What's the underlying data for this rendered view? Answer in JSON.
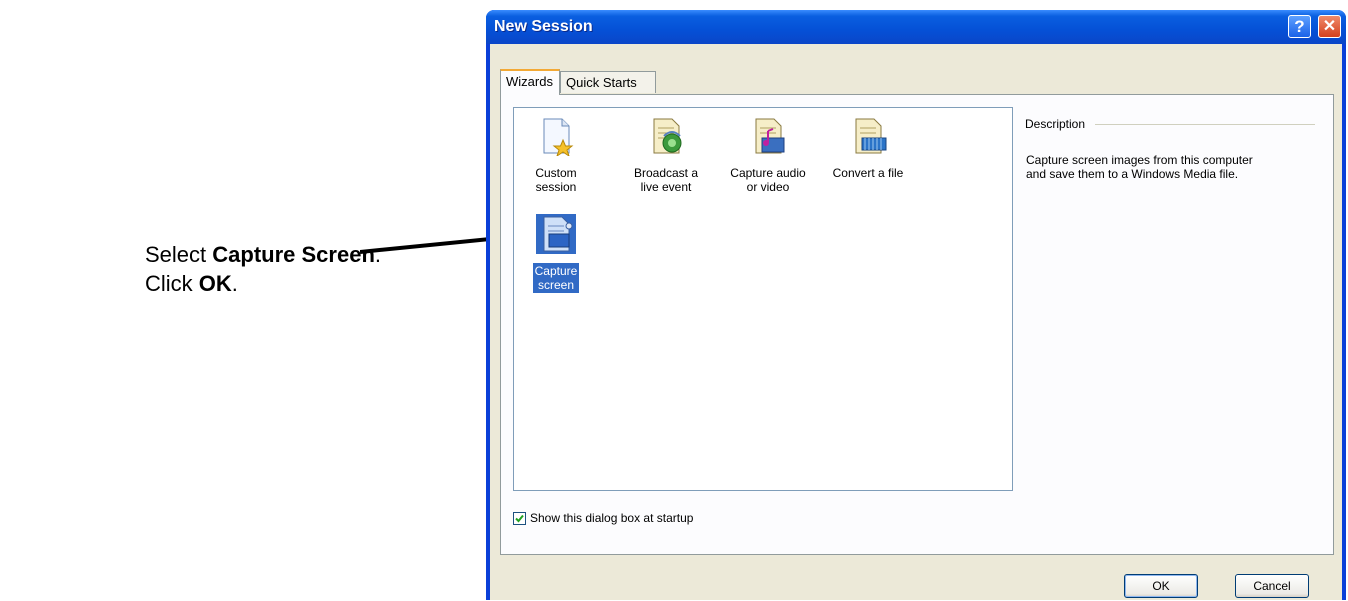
{
  "instruction": {
    "line1_prefix": "Select ",
    "line1_bold": "Capture Screen",
    "line1_suffix": ".",
    "line2_prefix": "Click ",
    "line2_bold": "OK",
    "line2_suffix": "."
  },
  "dialog": {
    "title": "New Session",
    "help_label": "?",
    "close_label": "✕"
  },
  "tabs": [
    {
      "label": "Wizards",
      "active": true
    },
    {
      "label": "Quick Starts",
      "active": false
    }
  ],
  "wizards": [
    {
      "label_line1": "Custom",
      "label_line2": "session",
      "icon": "custom-session-icon"
    },
    {
      "label_line1": "Broadcast a",
      "label_line2": "live event",
      "icon": "broadcast-icon"
    },
    {
      "label_line1": "Capture audio",
      "label_line2": "or video",
      "icon": "capture-audio-video-icon"
    },
    {
      "label_line1": "Convert a file",
      "label_line2": "",
      "icon": "convert-file-icon"
    },
    {
      "label_line1": "Capture",
      "label_line2": "screen",
      "icon": "capture-screen-icon",
      "selected": true
    }
  ],
  "description": {
    "heading": "Description",
    "line1": "Capture screen images from this computer",
    "line2": "and save them to a Windows Media file."
  },
  "startup_checkbox": {
    "label": "Show this dialog box at startup",
    "checked": true
  },
  "buttons": {
    "ok": "OK",
    "cancel": "Cancel"
  },
  "colors": {
    "title_bar": "#0550d6",
    "selection": "#316ac5",
    "dialog_face": "#ece9d8"
  }
}
